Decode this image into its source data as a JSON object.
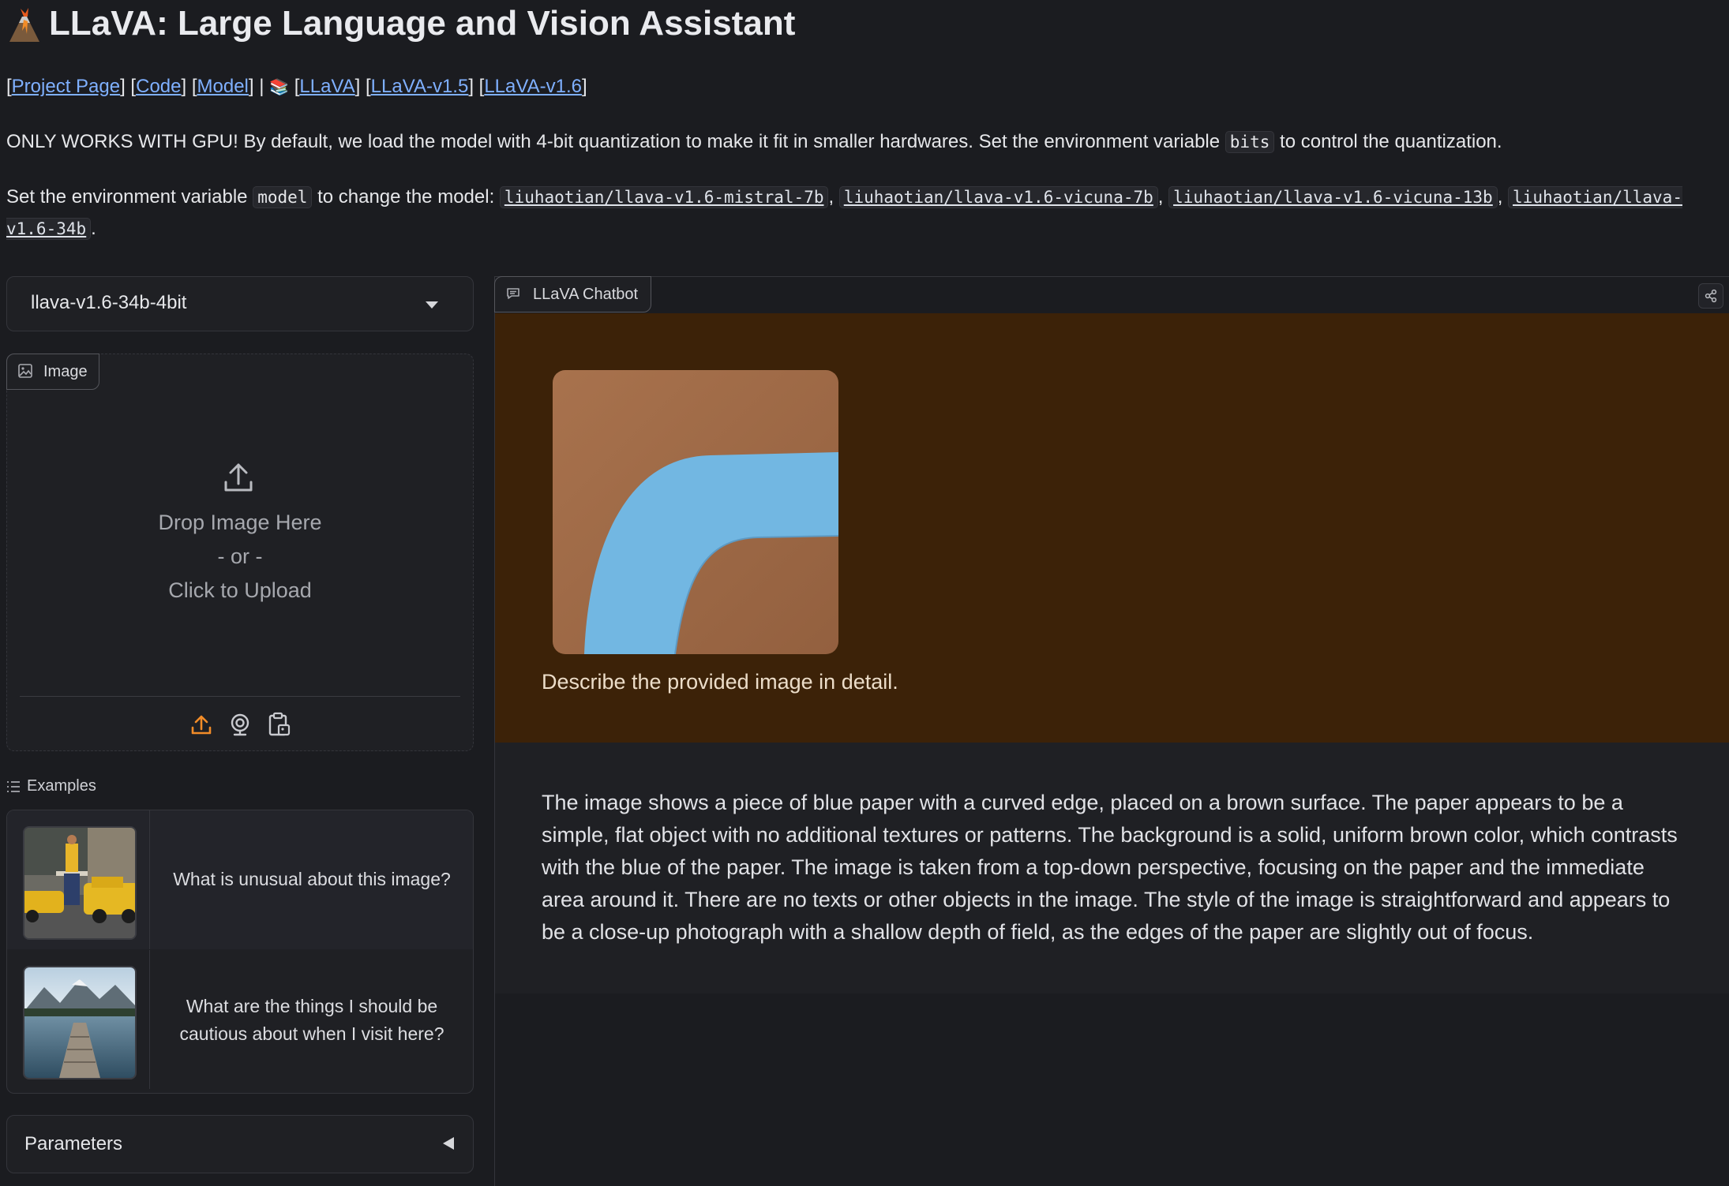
{
  "header": {
    "title": "LLaVA: Large Language and Vision Assistant",
    "logo_icon": "volcano-icon"
  },
  "links": {
    "project_page": "Project Page",
    "code": "Code",
    "model": "Model",
    "separator": "|",
    "books_icon": "books-icon",
    "llava": "LLaVA",
    "llava_v15": "LLaVA-v1.5",
    "llava_v16": "LLaVA-v1.6"
  },
  "notice": {
    "text_before": "ONLY WORKS WITH GPU! By default, we load the model with 4-bit quantization to make it fit in smaller hardwares. Set the environment variable",
    "code": "bits",
    "text_after": "to control the quantization."
  },
  "model_info": {
    "text_before": "Set the environment variable",
    "code": "model",
    "text_after": "to change the model:",
    "models": [
      "liuhaotian/llava-v1.6-mistral-7b",
      "liuhaotian/llava-v1.6-vicuna-7b",
      "liuhaotian/llava-v1.6-vicuna-13b",
      "liuhaotian/llava-v1.6-34b"
    ],
    "period": "."
  },
  "model_dropdown": {
    "selected": "llava-v1.6-34b-4bit"
  },
  "image_input": {
    "label": "Image",
    "drop_text": "Drop Image Here",
    "or_text": "- or -",
    "click_text": "Click to Upload",
    "sources": [
      "upload-icon",
      "webcam-icon",
      "clipboard-icon"
    ]
  },
  "examples": {
    "label": "Examples",
    "items": [
      {
        "text": "What is unusual about this image?",
        "thumb": "taxi-ironing-thumbnail"
      },
      {
        "text": "What are the things I should be cautious about when I visit here?",
        "thumb": "lake-dock-thumbnail"
      }
    ]
  },
  "parameters": {
    "label": "Parameters"
  },
  "chatbot": {
    "label": "LLaVA Chatbot",
    "user_message": "Describe the provided image in detail.",
    "bot_message": "The image shows a piece of blue paper with a curved edge, placed on a brown surface. The paper appears to be a simple, flat object with no additional textures or patterns. The background is a solid, uniform brown color, which contrasts with the blue of the paper. The image is taken from a top-down perspective, focusing on the paper and the immediate area around it. There are no texts or other objects in the image. The style of the image is straightforward and appears to be a close-up photograph with a shallow depth of field, as the edges of the paper are slightly out of focus."
  },
  "colors": {
    "background": "#1b1c20",
    "panel": "#1f2024",
    "user_bubble": "#3c2208",
    "link": "#7fb0ff",
    "accent_orange": "#f28c28"
  }
}
